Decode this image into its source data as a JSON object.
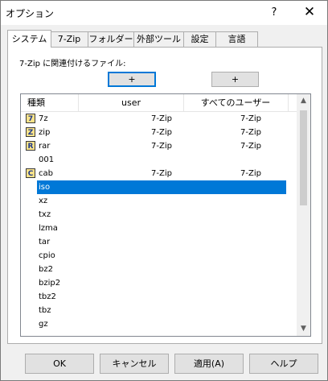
{
  "window": {
    "title": "オプション",
    "help": "?",
    "close": "✕"
  },
  "tabs": [
    "システム",
    "7-Zip",
    "フォルダー",
    "外部ツール",
    "設定",
    "言語"
  ],
  "assoc_label": "7-Zip に関連付けるファイル:",
  "plus_buttons": [
    "+",
    "+"
  ],
  "list": {
    "headers": [
      "種類",
      "user",
      "すべてのユーザー"
    ],
    "rows": [
      {
        "name": "7z",
        "user": "7-Zip",
        "all": "7-Zip",
        "icon": "7"
      },
      {
        "name": "zip",
        "user": "7-Zip",
        "all": "7-Zip",
        "icon": "Z"
      },
      {
        "name": "rar",
        "user": "7-Zip",
        "all": "7-Zip",
        "icon": "R"
      },
      {
        "name": "001",
        "user": "",
        "all": "",
        "icon": ""
      },
      {
        "name": "cab",
        "user": "7-Zip",
        "all": "7-Zip",
        "icon": "C"
      },
      {
        "name": "iso",
        "user": "",
        "all": "",
        "icon": "",
        "selected": true
      },
      {
        "name": "xz",
        "user": "",
        "all": "",
        "icon": ""
      },
      {
        "name": "txz",
        "user": "",
        "all": "",
        "icon": ""
      },
      {
        "name": "lzma",
        "user": "",
        "all": "",
        "icon": ""
      },
      {
        "name": "tar",
        "user": "",
        "all": "",
        "icon": ""
      },
      {
        "name": "cpio",
        "user": "",
        "all": "",
        "icon": ""
      },
      {
        "name": "bz2",
        "user": "",
        "all": "",
        "icon": ""
      },
      {
        "name": "bzip2",
        "user": "",
        "all": "",
        "icon": ""
      },
      {
        "name": "tbz2",
        "user": "",
        "all": "",
        "icon": ""
      },
      {
        "name": "tbz",
        "user": "",
        "all": "",
        "icon": ""
      },
      {
        "name": "gz",
        "user": "",
        "all": "",
        "icon": ""
      }
    ]
  },
  "footer": {
    "ok": "OK",
    "cancel": "キャンセル",
    "apply": "適用(A)",
    "help": "ヘルプ"
  }
}
